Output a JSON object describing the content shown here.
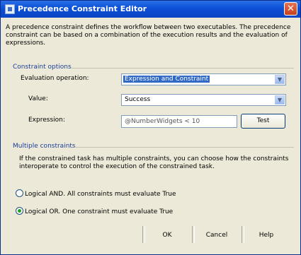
{
  "window": {
    "title": "Precedence Constraint Editor",
    "close_glyph": "✕"
  },
  "description": "A precedence constraint defines the workflow between two executables. The precedence constraint can be based on a combination of the execution results and the evaluation of expressions.",
  "constraint_options": {
    "section_title": "Constraint options",
    "evaluation_operation_label": "Evaluation operation:",
    "evaluation_operation_value": "Expression and Constraint",
    "value_label": "Value:",
    "value_value": "Success",
    "expression_label": "Expression:",
    "expression_value": "@NumberWidgets < 10",
    "test_button": "Test"
  },
  "multiple_constraints": {
    "section_title": "Multiple constraints",
    "description": "If the constrained task has multiple constraints, you can choose how the constraints interoperate to control the execution of the constrained task.",
    "option_and": "Logical AND. All constraints must evaluate True",
    "option_or": "Logical OR. One constraint must evaluate True",
    "selected": "or"
  },
  "buttons": {
    "ok": "OK",
    "cancel": "Cancel",
    "help": "Help"
  },
  "icons": {
    "dropdown": "▼"
  }
}
